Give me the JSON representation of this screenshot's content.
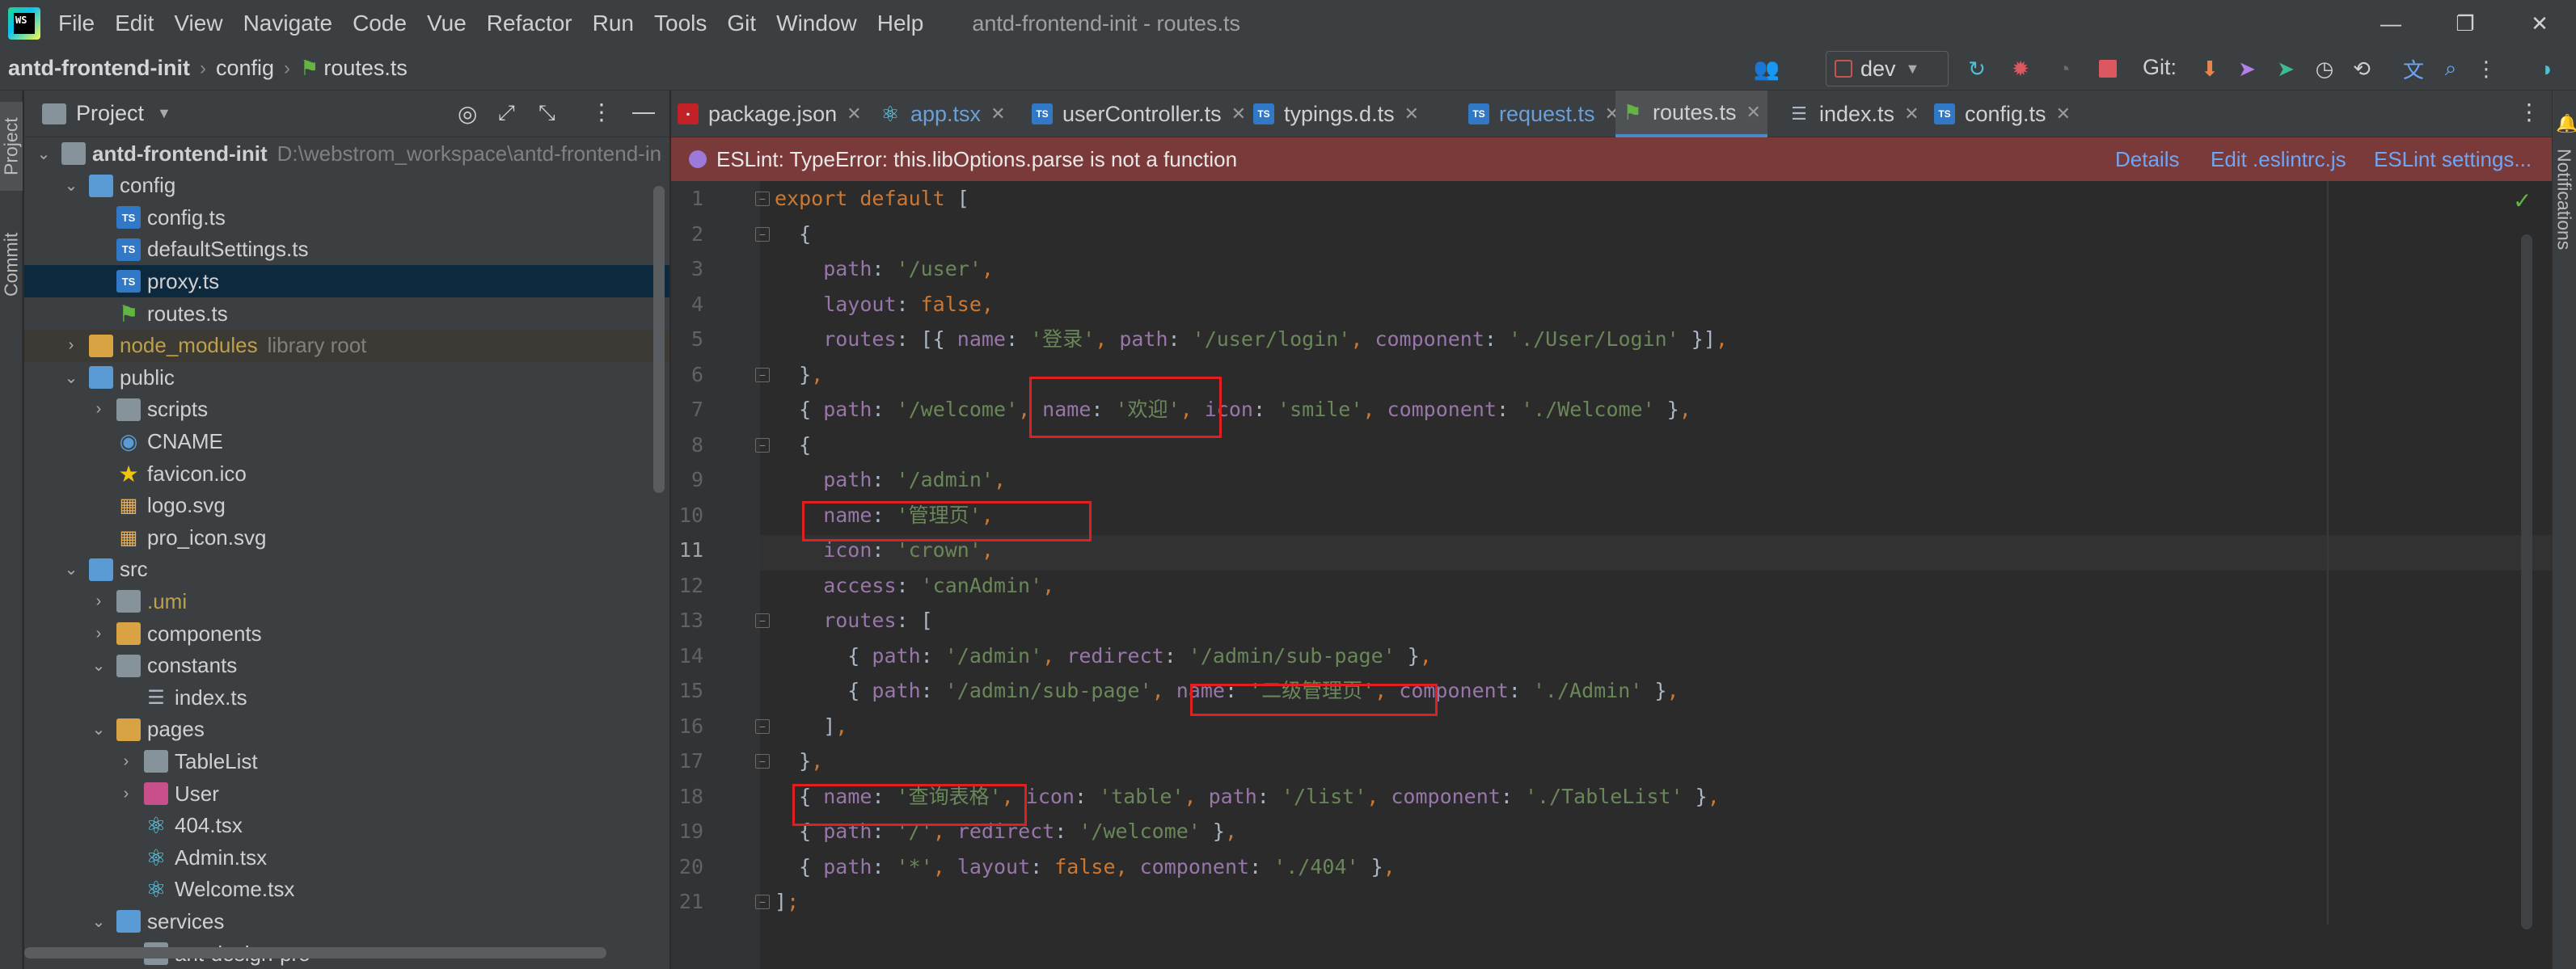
{
  "window": {
    "title": "antd-frontend-init - routes.ts",
    "menu": [
      "File",
      "Edit",
      "View",
      "Navigate",
      "Code",
      "Vue",
      "Refactor",
      "Run",
      "Tools",
      "Git",
      "Window",
      "Help"
    ],
    "controls": {
      "minimize": "—",
      "restore": "❐",
      "close": "✕"
    }
  },
  "navbar": {
    "breadcrumb": [
      "antd-frontend-init",
      "config",
      "routes.ts"
    ],
    "branch": "dev",
    "git_label": "Git:"
  },
  "side_tabs": {
    "project": "Project",
    "commit": "Commit",
    "notifications": "Notifications"
  },
  "project_panel": {
    "title": "Project",
    "tree": [
      {
        "depth": 0,
        "open": true,
        "icon": "folder",
        "label": "antd-frontend-init",
        "extra": "D:\\webstrom_workspace\\antd-frontend-in",
        "bold": true
      },
      {
        "depth": 1,
        "open": true,
        "icon": "folder-blue",
        "label": "config"
      },
      {
        "depth": 2,
        "icon": "ts",
        "label": "config.ts"
      },
      {
        "depth": 2,
        "icon": "ts",
        "label": "defaultSettings.ts"
      },
      {
        "depth": 2,
        "icon": "ts",
        "label": "proxy.ts",
        "selected": true
      },
      {
        "depth": 2,
        "icon": "route",
        "label": "routes.ts"
      },
      {
        "depth": 1,
        "open": false,
        "icon": "folder-orange",
        "label": "node_modules",
        "extra": "library root",
        "excluded": true
      },
      {
        "depth": 1,
        "open": true,
        "icon": "folder-blue",
        "label": "public"
      },
      {
        "depth": 2,
        "open": false,
        "icon": "folder",
        "label": "scripts"
      },
      {
        "depth": 2,
        "icon": "globe",
        "label": "CNAME"
      },
      {
        "depth": 2,
        "icon": "star",
        "label": "favicon.ico"
      },
      {
        "depth": 2,
        "icon": "svg",
        "label": "logo.svg"
      },
      {
        "depth": 2,
        "icon": "svg",
        "label": "pro_icon.svg"
      },
      {
        "depth": 1,
        "open": true,
        "icon": "folder-blue",
        "label": "src"
      },
      {
        "depth": 2,
        "open": false,
        "icon": "folder",
        "label": ".umi",
        "gold": true
      },
      {
        "depth": 2,
        "open": false,
        "icon": "folder-orange",
        "label": "components"
      },
      {
        "depth": 2,
        "open": true,
        "icon": "folder",
        "label": "constants"
      },
      {
        "depth": 3,
        "icon": "list",
        "label": "index.ts"
      },
      {
        "depth": 2,
        "open": true,
        "icon": "folder-orange",
        "label": "pages"
      },
      {
        "depth": 3,
        "open": false,
        "icon": "folder",
        "label": "TableList"
      },
      {
        "depth": 3,
        "open": false,
        "icon": "folder-pink",
        "label": "User"
      },
      {
        "depth": 3,
        "icon": "react",
        "label": "404.tsx"
      },
      {
        "depth": 3,
        "icon": "react",
        "label": "Admin.tsx"
      },
      {
        "depth": 3,
        "icon": "react",
        "label": "Welcome.tsx"
      },
      {
        "depth": 2,
        "open": true,
        "icon": "folder-blue",
        "label": "services"
      },
      {
        "depth": 3,
        "open": false,
        "icon": "folder",
        "label": "ant-design-pro"
      }
    ]
  },
  "tabs": [
    {
      "label": "package.json",
      "icon": "npm",
      "blue": false
    },
    {
      "label": "app.tsx",
      "icon": "react",
      "blue": true
    },
    {
      "label": "userController.ts",
      "icon": "ts",
      "blue": false
    },
    {
      "label": "typings.d.ts",
      "icon": "ts-d",
      "blue": false
    },
    {
      "label": "request.ts",
      "icon": "ts",
      "blue": true
    },
    {
      "label": "routes.ts",
      "icon": "route",
      "blue": false,
      "active": true
    },
    {
      "label": "index.ts",
      "icon": "list",
      "blue": false
    },
    {
      "label": "config.ts",
      "icon": "ts",
      "blue": false
    }
  ],
  "eslint_banner": {
    "message": "ESLint: TypeError: this.libOptions.parse is not a function",
    "links": [
      "Details",
      "Edit .eslintrc.js",
      "ESLint settings..."
    ]
  },
  "editor": {
    "current_line": 11,
    "lines": [
      [
        [
          "kw",
          "export default "
        ],
        [
          "p",
          "["
        ]
      ],
      [
        [
          "p",
          "  {"
        ]
      ],
      [
        [
          "pr",
          "    path"
        ],
        [
          "p",
          ": "
        ],
        [
          "st",
          "'/user'"
        ],
        [
          "pn",
          ","
        ]
      ],
      [
        [
          "pr",
          "    layout"
        ],
        [
          "p",
          ": "
        ],
        [
          "kw",
          "false"
        ],
        [
          "pn",
          ","
        ]
      ],
      [
        [
          "pr",
          "    routes"
        ],
        [
          "p",
          ": [{ "
        ],
        [
          "pr",
          "name"
        ],
        [
          "p",
          ": "
        ],
        [
          "st",
          "'登录'"
        ],
        [
          "pn",
          ", "
        ],
        [
          "pr",
          "path"
        ],
        [
          "p",
          ": "
        ],
        [
          "st",
          "'/user/login'"
        ],
        [
          "pn",
          ", "
        ],
        [
          "pr",
          "component"
        ],
        [
          "p",
          ": "
        ],
        [
          "st",
          "'./User/Login'"
        ],
        [
          "p",
          " }]"
        ],
        [
          "pn",
          ","
        ]
      ],
      [
        [
          "p",
          "  }"
        ],
        [
          "pn",
          ","
        ]
      ],
      [
        [
          "p",
          "  { "
        ],
        [
          "pr",
          "path"
        ],
        [
          "p",
          ": "
        ],
        [
          "st",
          "'/welcome'"
        ],
        [
          "pn",
          ", "
        ],
        [
          "pr",
          "name"
        ],
        [
          "p",
          ": "
        ],
        [
          "st",
          "'欢迎'"
        ],
        [
          "pn",
          ", "
        ],
        [
          "pr",
          "icon"
        ],
        [
          "p",
          ": "
        ],
        [
          "st",
          "'smile'"
        ],
        [
          "pn",
          ", "
        ],
        [
          "pr",
          "component"
        ],
        [
          "p",
          ": "
        ],
        [
          "st",
          "'./Welcome'"
        ],
        [
          "p",
          " }"
        ],
        [
          "pn",
          ","
        ]
      ],
      [
        [
          "p",
          "  {"
        ]
      ],
      [
        [
          "pr",
          "    path"
        ],
        [
          "p",
          ": "
        ],
        [
          "st",
          "'/admin'"
        ],
        [
          "pn",
          ","
        ]
      ],
      [
        [
          "pr",
          "    name"
        ],
        [
          "p",
          ": "
        ],
        [
          "st",
          "'管理页'"
        ],
        [
          "pn",
          ","
        ]
      ],
      [
        [
          "pr",
          "    icon"
        ],
        [
          "p",
          ": "
        ],
        [
          "st",
          "'crown'"
        ],
        [
          "pn",
          ","
        ]
      ],
      [
        [
          "pr",
          "    access"
        ],
        [
          "p",
          ": "
        ],
        [
          "st",
          "'canAdmin'"
        ],
        [
          "pn",
          ","
        ]
      ],
      [
        [
          "pr",
          "    routes"
        ],
        [
          "p",
          ": ["
        ]
      ],
      [
        [
          "p",
          "      { "
        ],
        [
          "pr",
          "path"
        ],
        [
          "p",
          ": "
        ],
        [
          "st",
          "'/admin'"
        ],
        [
          "pn",
          ", "
        ],
        [
          "pr",
          "redirect"
        ],
        [
          "p",
          ": "
        ],
        [
          "st",
          "'/admin/sub-page'"
        ],
        [
          "p",
          " }"
        ],
        [
          "pn",
          ","
        ]
      ],
      [
        [
          "p",
          "      { "
        ],
        [
          "pr",
          "path"
        ],
        [
          "p",
          ": "
        ],
        [
          "st",
          "'/admin/sub-page'"
        ],
        [
          "pn",
          ", "
        ],
        [
          "pr",
          "name"
        ],
        [
          "p",
          ": "
        ],
        [
          "st",
          "'二级管理页'"
        ],
        [
          "pn",
          ", "
        ],
        [
          "pr",
          "component"
        ],
        [
          "p",
          ": "
        ],
        [
          "st",
          "'./Admin'"
        ],
        [
          "p",
          " }"
        ],
        [
          "pn",
          ","
        ]
      ],
      [
        [
          "p",
          "    ]"
        ],
        [
          "pn",
          ","
        ]
      ],
      [
        [
          "p",
          "  }"
        ],
        [
          "pn",
          ","
        ]
      ],
      [
        [
          "p",
          "  { "
        ],
        [
          "pr",
          "name"
        ],
        [
          "p",
          ": "
        ],
        [
          "st",
          "'查询表格'"
        ],
        [
          "pn",
          ", "
        ],
        [
          "pr",
          "icon"
        ],
        [
          "p",
          ": "
        ],
        [
          "st",
          "'table'"
        ],
        [
          "pn",
          ", "
        ],
        [
          "pr",
          "path"
        ],
        [
          "p",
          ": "
        ],
        [
          "st",
          "'/list'"
        ],
        [
          "pn",
          ", "
        ],
        [
          "pr",
          "component"
        ],
        [
          "p",
          ": "
        ],
        [
          "st",
          "'./TableList'"
        ],
        [
          "p",
          " }"
        ],
        [
          "pn",
          ","
        ]
      ],
      [
        [
          "p",
          "  { "
        ],
        [
          "pr",
          "path"
        ],
        [
          "p",
          ": "
        ],
        [
          "st",
          "'/'"
        ],
        [
          "pn",
          ", "
        ],
        [
          "pr",
          "redirect"
        ],
        [
          "p",
          ": "
        ],
        [
          "st",
          "'/welcome'"
        ],
        [
          "p",
          " }"
        ],
        [
          "pn",
          ","
        ]
      ],
      [
        [
          "p",
          "  { "
        ],
        [
          "pr",
          "path"
        ],
        [
          "p",
          ": "
        ],
        [
          "st",
          "'*'"
        ],
        [
          "pn",
          ", "
        ],
        [
          "pr",
          "layout"
        ],
        [
          "p",
          ": "
        ],
        [
          "kw",
          "false"
        ],
        [
          "pn",
          ", "
        ],
        [
          "pr",
          "component"
        ],
        [
          "p",
          ": "
        ],
        [
          "st",
          "'./404'"
        ],
        [
          "p",
          " }"
        ],
        [
          "pn",
          ","
        ]
      ],
      [
        [
          "p",
          "]"
        ],
        [
          "pn",
          ";"
        ]
      ]
    ]
  }
}
